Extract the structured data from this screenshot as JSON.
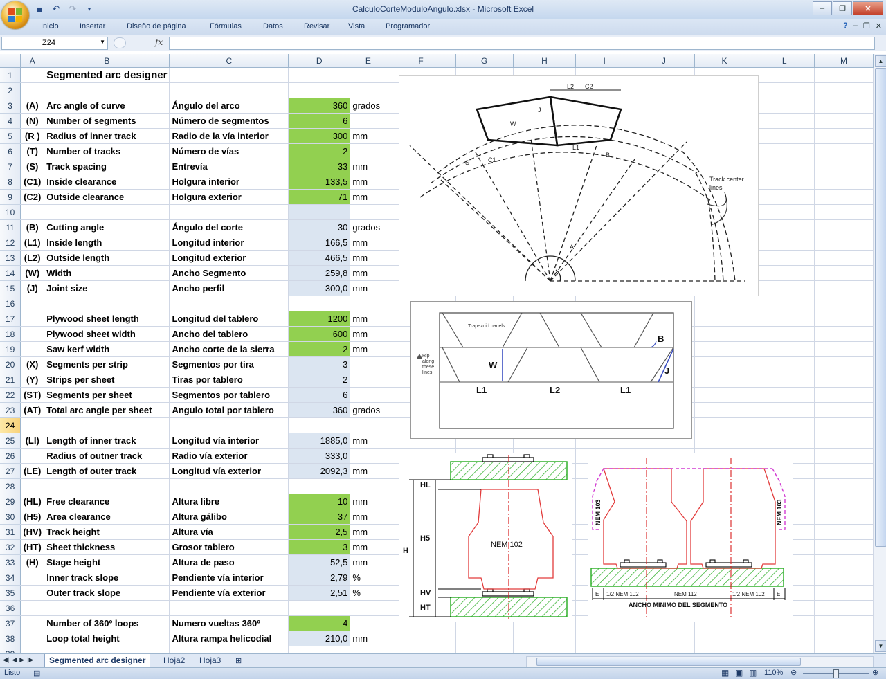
{
  "window": {
    "title": "CalculoCorteModuloAngulo.xlsx - Microsoft Excel"
  },
  "ribbon": {
    "tabs": [
      "Inicio",
      "Insertar",
      "Diseño de página",
      "Fórmulas",
      "Datos",
      "Revisar",
      "Vista",
      "Programador"
    ]
  },
  "formula_bar": {
    "cell_ref": "Z24",
    "fx": "fx",
    "formula": ""
  },
  "columns": [
    "A",
    "B",
    "C",
    "D",
    "E",
    "F",
    "G",
    "H",
    "I",
    "J",
    "K",
    "L",
    "M"
  ],
  "sheet": {
    "title": "Segmented arc designer",
    "rows": [
      {
        "row": "1",
        "a": "",
        "b": "Segmented arc designer",
        "c": "",
        "d": "",
        "e": "",
        "fill": ""
      },
      {
        "row": "2",
        "a": "",
        "b": "",
        "c": "",
        "d": "",
        "e": "",
        "fill": ""
      },
      {
        "row": "3",
        "a": "(A)",
        "b": "Arc angle of curve",
        "c": "Ángulo del arco",
        "d": "360",
        "e": "grados",
        "fill": "green"
      },
      {
        "row": "4",
        "a": "(N)",
        "b": "Number of segments",
        "c": "Número de segmentos",
        "d": "6",
        "e": "",
        "fill": "green"
      },
      {
        "row": "5",
        "a": "(R )",
        "b": "Radius of inner track",
        "c": "Radio de la vía interior",
        "d": "300",
        "e": "mm",
        "fill": "green"
      },
      {
        "row": "6",
        "a": "(T)",
        "b": "Number of tracks",
        "c": "Número de vías",
        "d": "2",
        "e": "",
        "fill": "green"
      },
      {
        "row": "7",
        "a": "(S)",
        "b": "Track spacing",
        "c": "Entrevía",
        "d": "33",
        "e": "mm",
        "fill": "green"
      },
      {
        "row": "8",
        "a": "(C1)",
        "b": "Inside clearance",
        "c": "Holgura interior",
        "d": "133,5",
        "e": "mm",
        "fill": "green"
      },
      {
        "row": "9",
        "a": "(C2)",
        "b": "Outside clearance",
        "c": "Holgura exterior",
        "d": "71",
        "e": "mm",
        "fill": "green"
      },
      {
        "row": "10",
        "a": "",
        "b": "",
        "c": "",
        "d": "",
        "e": "",
        "fill": "blue"
      },
      {
        "row": "11",
        "a": "(B)",
        "b": "Cutting angle",
        "c": "Ángulo del corte",
        "d": "30",
        "e": "grados",
        "fill": "blue"
      },
      {
        "row": "12",
        "a": "(L1)",
        "b": "Inside length",
        "c": "Longitud interior",
        "d": "166,5",
        "e": "mm",
        "fill": "blue"
      },
      {
        "row": "13",
        "a": "(L2)",
        "b": "Outside length",
        "c": "Longitud exterior",
        "d": "466,5",
        "e": "mm",
        "fill": "blue"
      },
      {
        "row": "14",
        "a": "(W)",
        "b": "Width",
        "c": "Ancho Segmento",
        "d": "259,8",
        "e": "mm",
        "fill": "blue"
      },
      {
        "row": "15",
        "a": "(J)",
        "b": "Joint size",
        "c": "Ancho perfil",
        "d": "300,0",
        "e": "mm",
        "fill": "blue"
      },
      {
        "row": "16",
        "a": "",
        "b": "",
        "c": "",
        "d": "",
        "e": "",
        "fill": ""
      },
      {
        "row": "17",
        "a": "",
        "b": "Plywood sheet length",
        "c": "Longitud del tablero",
        "d": "1200",
        "e": "mm",
        "fill": "green"
      },
      {
        "row": "18",
        "a": "",
        "b": "Plywood sheet width",
        "c": "Ancho del tablero",
        "d": "600",
        "e": "mm",
        "fill": "green"
      },
      {
        "row": "19",
        "a": "",
        "b": "Saw kerf width",
        "c": "Ancho corte de la sierra",
        "d": "2",
        "e": "mm",
        "fill": "green"
      },
      {
        "row": "20",
        "a": "(X)",
        "b": "Segments per strip",
        "c": "Segmentos por tira",
        "d": "3",
        "e": "",
        "fill": "blue"
      },
      {
        "row": "21",
        "a": "(Y)",
        "b": "Strips per sheet",
        "c": "Tiras por tablero",
        "d": "2",
        "e": "",
        "fill": "blue"
      },
      {
        "row": "22",
        "a": "(ST)",
        "b": "Segments per sheet",
        "c": "Segmentos por tablero",
        "d": "6",
        "e": "",
        "fill": "blue"
      },
      {
        "row": "23",
        "a": "(AT)",
        "b": "Total arc angle per sheet",
        "c": "Angulo total por tablero",
        "d": "360",
        "e": "grados",
        "fill": "blue"
      },
      {
        "row": "24",
        "a": "",
        "b": "",
        "c": "",
        "d": "",
        "e": "",
        "fill": ""
      },
      {
        "row": "25",
        "a": "(LI)",
        "b": "Length of inner track",
        "c": "Longitud vía interior",
        "d": "1885,0",
        "e": "mm",
        "fill": "blue"
      },
      {
        "row": "26",
        "a": "",
        "b": "Radius of outner track",
        "c": "Radio vía exterior",
        "d": "333,0",
        "e": "",
        "fill": "blue"
      },
      {
        "row": "27",
        "a": "(LE)",
        "b": "Length of outer track",
        "c": "Longitud vía exterior",
        "d": "2092,3",
        "e": "mm",
        "fill": "blue"
      },
      {
        "row": "28",
        "a": "",
        "b": "",
        "c": "",
        "d": "",
        "e": "",
        "fill": ""
      },
      {
        "row": "29",
        "a": "(HL)",
        "b": "Free clearance",
        "c": "Altura libre",
        "d": "10",
        "e": "mm",
        "fill": "green"
      },
      {
        "row": "30",
        "a": "(H5)",
        "b": "Area clearance",
        "c": "Altura gálibo",
        "d": "37",
        "e": "mm",
        "fill": "green"
      },
      {
        "row": "31",
        "a": "(HV)",
        "b": "Track height",
        "c": "Altura vía",
        "d": "2,5",
        "e": "mm",
        "fill": "green"
      },
      {
        "row": "32",
        "a": "(HT)",
        "b": "Sheet thickness",
        "c": "Grosor tablero",
        "d": "3",
        "e": "mm",
        "fill": "green"
      },
      {
        "row": "33",
        "a": "(H)",
        "b": "Stage height",
        "c": "Altura de paso",
        "d": "52,5",
        "e": "mm",
        "fill": "blue"
      },
      {
        "row": "34",
        "a": "",
        "b": "Inner track slope",
        "c": "Pendiente vía interior",
        "d": "2,79",
        "e": "%",
        "fill": "blue"
      },
      {
        "row": "35",
        "a": "",
        "b": "Outer track slope",
        "c": "Pendiente vía exterior",
        "d": "2,51",
        "e": "%",
        "fill": "blue"
      },
      {
        "row": "36",
        "a": "",
        "b": "",
        "c": "",
        "d": "",
        "e": "",
        "fill": ""
      },
      {
        "row": "37",
        "a": "",
        "b": "Number of 360º loops",
        "c": "Numero vueltas 360º",
        "d": "4",
        "e": "",
        "fill": "green"
      },
      {
        "row": "38",
        "a": "",
        "b": "Loop total height",
        "c": "Altura rampa helicodial",
        "d": "210,0",
        "e": "mm",
        "fill": "blue"
      },
      {
        "row": "39",
        "a": "",
        "b": "",
        "c": "",
        "d": "",
        "e": "",
        "fill": ""
      }
    ]
  },
  "diagrams": {
    "arc": {
      "labels": [
        "L2",
        "C2",
        "J",
        "W",
        "L1",
        "B",
        "C1",
        "S",
        "A",
        "Track center",
        "lines"
      ]
    },
    "plywood": {
      "panel_label": "Trapezoid panels",
      "rip": [
        "Rip",
        "along",
        "these",
        "lines"
      ],
      "labels": [
        "B",
        "W",
        "J",
        "L1",
        "L2",
        "L1"
      ]
    },
    "profile": {
      "labels": [
        "HL",
        "H5",
        "H",
        "HV",
        "HT",
        "NEM 102"
      ]
    },
    "double": {
      "labels": [
        "NEM 103",
        "NEM 103",
        "E",
        "1/2 NEM 102",
        "NEM 112",
        "1/2 NEM 102",
        "E",
        "ANCHO MINIMO DEL SEGMENTO"
      ]
    }
  },
  "sheet_tabs": [
    "Segmented arc designer",
    "Hoja2",
    "Hoja3"
  ],
  "status": {
    "ready": "Listo",
    "zoom": "110%"
  },
  "colors": {
    "input_fill": "#92d050",
    "calc_fill": "#dbe5f1",
    "title_red": "#e00000"
  }
}
